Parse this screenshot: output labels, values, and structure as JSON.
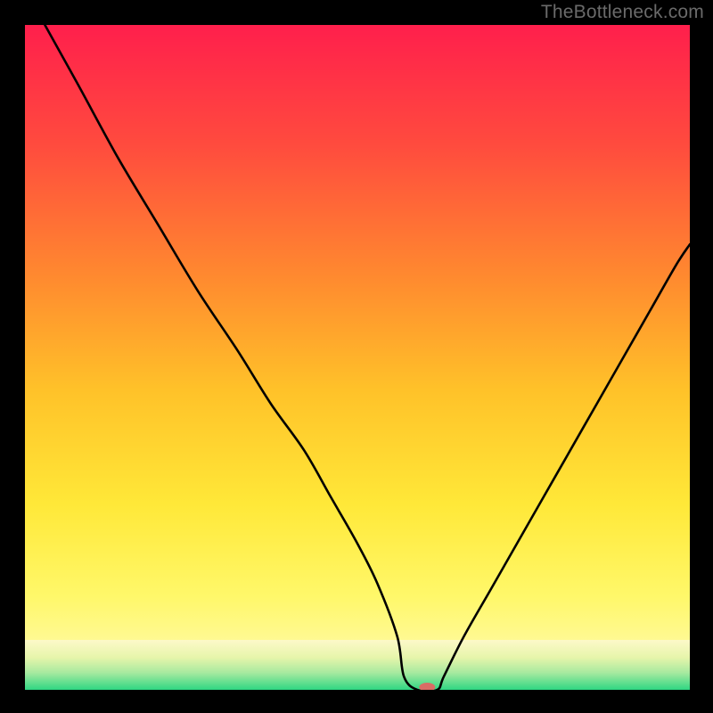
{
  "watermark": "TheBottleneck.com",
  "chart_data": {
    "type": "line",
    "title": "",
    "xlabel": "",
    "ylabel": "",
    "xlim": [
      0,
      100
    ],
    "ylim": [
      0,
      100
    ],
    "grid": false,
    "series": [
      {
        "name": "curve",
        "x": [
          3,
          8,
          14,
          20,
          26,
          32,
          37,
          42,
          46,
          50,
          53,
          56,
          57,
          59,
          62,
          63,
          66,
          70,
          74,
          78,
          82,
          86,
          90,
          94,
          98,
          100
        ],
        "y": [
          100,
          91,
          80,
          70,
          60,
          51,
          43,
          36,
          29,
          22,
          16,
          8,
          2,
          0,
          0,
          2,
          8,
          15,
          22,
          29,
          36,
          43,
          50,
          57,
          64,
          67
        ]
      }
    ],
    "marker": {
      "x": 60.5,
      "y": 0,
      "color": "#d96d65",
      "rx": 9,
      "ry": 5
    },
    "floor_band": {
      "from_y_pct": 92.5,
      "stops": [
        {
          "offset": 0,
          "color": "#fdf9c9"
        },
        {
          "offset": 35,
          "color": "#e7f5ab"
        },
        {
          "offset": 65,
          "color": "#a9eaa0"
        },
        {
          "offset": 100,
          "color": "#2fd783"
        }
      ]
    },
    "background_stops": [
      {
        "offset": 0,
        "color": "#ff1f4c"
      },
      {
        "offset": 18,
        "color": "#ff4b3e"
      },
      {
        "offset": 38,
        "color": "#ff8a2f"
      },
      {
        "offset": 55,
        "color": "#ffc229"
      },
      {
        "offset": 72,
        "color": "#ffe838"
      },
      {
        "offset": 86,
        "color": "#fff86a"
      },
      {
        "offset": 100,
        "color": "#fffbc0"
      }
    ]
  }
}
